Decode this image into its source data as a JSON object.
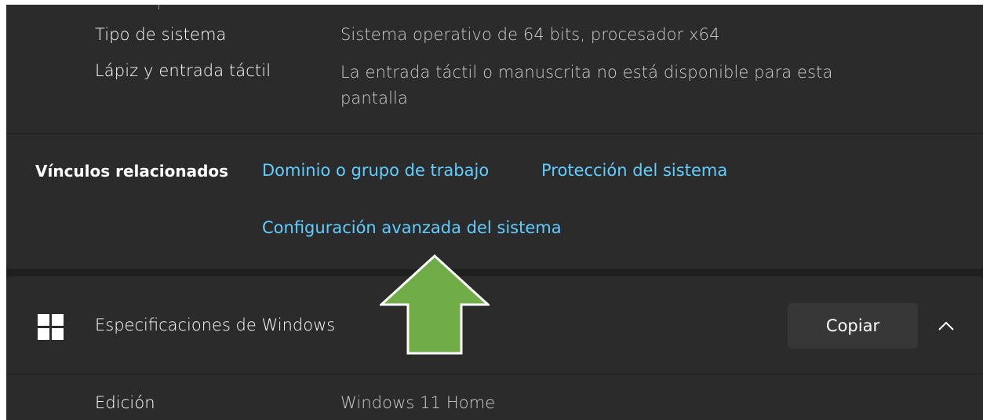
{
  "system_specs": {
    "rows": [
      {
        "label": "Tipo de sistema",
        "value": "Sistema operativo de 64 bits, procesador x64"
      },
      {
        "label": "Lápiz y entrada táctil",
        "value_line1": "La entrada táctil o manuscrita no está disponible para esta",
        "value_line2": "pantalla"
      }
    ]
  },
  "related_links": {
    "title": "Vínculos relacionados",
    "links": [
      {
        "label": "Dominio o grupo de trabajo"
      },
      {
        "label": "Protección del sistema"
      },
      {
        "label": "Configuración avanzada del sistema"
      }
    ],
    "link_color": "#60cdff"
  },
  "windows_specs": {
    "icon": "windows-logo-icon",
    "title": "Especificaciones de Windows",
    "copy_label": "Copiar",
    "expand_icon": "chevron-up-icon",
    "rows": [
      {
        "label": "Edición",
        "value": "Windows 11 Home"
      }
    ]
  },
  "annotation": {
    "icon": "up-arrow-icon",
    "color": "#70ad47"
  }
}
